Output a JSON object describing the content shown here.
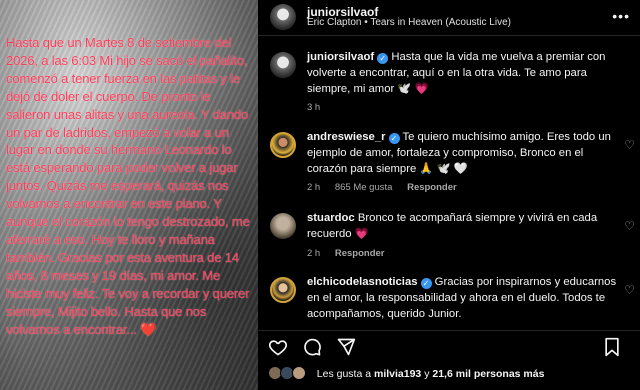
{
  "photo": {
    "caption": "Hasta que un Martes 8 de setiembre del 2026, a las 6:03 Mi hijo se sacó el pañalito, comenzó a tener fuerza en las patitas y le dejó de doler el cuerpo. De pronto le salieron unas alitas y una aureola. Y dando un par de ladridos, empezó a volar a un lugar en donde su hermano Leonardo lo está esperando para poder volver a jugar juntos. Quizás me esperará, quizás nos volvamos a encontrar en este plano. Y aunque el corazón lo tengo destrozado, me aferraré a eso. Hoy te lloro y mañana también. Gracias por esta aventura de 14 años, 8 meses y 19 días, mi amor. Me hiciste muy feliz. Te voy a recordar y querer siempre, Mijito bello. Hasta que nos volvamos a encontrar... ❤️"
  },
  "header": {
    "username": "juniorsilvaof",
    "song": "Eric Clapton • Tears in Heaven (Acoustic Live)",
    "more": "•••"
  },
  "post": {
    "username": "juniorsilvaof",
    "text": "Hasta que la vida me vuelva a premiar con volverte a encontrar, aquí o en la otra vida. Te amo para siempre, mi amor 🕊️ 💗",
    "time": "3 h"
  },
  "comments": [
    {
      "username": "andreswiese_r",
      "verified": true,
      "text": "Te quiero muchísimo amigo. Eres todo un ejemplo de amor, fortaleza y compromiso, Bronco en el corazón para siempre 🙏 🕊️ 🤍",
      "time": "2 h",
      "likes": "865 Me gusta",
      "reply": "Responder"
    },
    {
      "username": "stuardoc",
      "verified": false,
      "text": "Bronco te acompañará siempre y vivirá en cada recuerdo 💗",
      "time": "2 h",
      "likes": "",
      "reply": "Responder"
    },
    {
      "username": "elchicodelasnoticias",
      "verified": true,
      "text": "Gracias por inspirarnos y educarnos en el amor, la responsabilidad y ahora en el duelo. Todos te acompañamos, querido Junior.",
      "time": "",
      "likes": "",
      "reply": ""
    }
  ],
  "likes_bar": {
    "prefix": "Les gusta a ",
    "user": "milvia193",
    "middle": " y ",
    "count": "21,6 mil personas más"
  },
  "icons": [
    "heart-icon",
    "comment-icon",
    "share-icon",
    "bookmark-icon",
    "more-icon"
  ],
  "colors": {
    "caption": "#ff3d5a",
    "verified": "#3897f0",
    "muted": "#a8a8a8",
    "background": "#000000"
  }
}
